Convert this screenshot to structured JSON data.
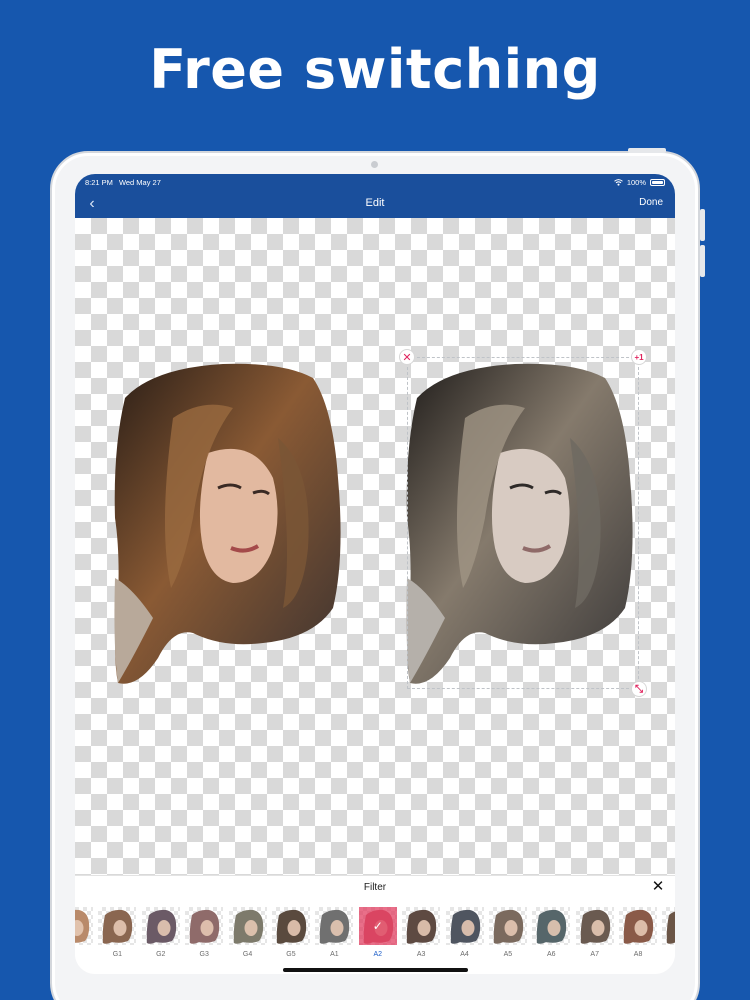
{
  "headline": "Free switching",
  "status_bar": {
    "time": "8:21 PM",
    "date": "Wed May 27",
    "battery": "100%"
  },
  "nav": {
    "title": "Edit",
    "done_label": "Done"
  },
  "filter_panel": {
    "title": "Filter",
    "selected": "A2",
    "items": [
      {
        "label": "",
        "tone": "#b98a6a"
      },
      {
        "label": "G1",
        "tone": "#8a6650"
      },
      {
        "label": "G2",
        "tone": "#6b5a66"
      },
      {
        "label": "G3",
        "tone": "#8f6b6a"
      },
      {
        "label": "G4",
        "tone": "#7d7a6b"
      },
      {
        "label": "G5",
        "tone": "#5a4a3e"
      },
      {
        "label": "A1",
        "tone": "#707070"
      },
      {
        "label": "A2",
        "tone": "#c86a72"
      },
      {
        "label": "A3",
        "tone": "#5e4a42"
      },
      {
        "label": "A4",
        "tone": "#4f5560"
      },
      {
        "label": "A5",
        "tone": "#7b6a5e"
      },
      {
        "label": "A6",
        "tone": "#56666a"
      },
      {
        "label": "A7",
        "tone": "#6a5a50"
      },
      {
        "label": "A8",
        "tone": "#8a5a48"
      },
      {
        "label": "",
        "tone": "#6b5546"
      }
    ]
  },
  "colors": {
    "background": "#1657ae",
    "nav": "#1a4f9c",
    "accent": "#e0245e",
    "selected_label": "#1a5cc8"
  }
}
